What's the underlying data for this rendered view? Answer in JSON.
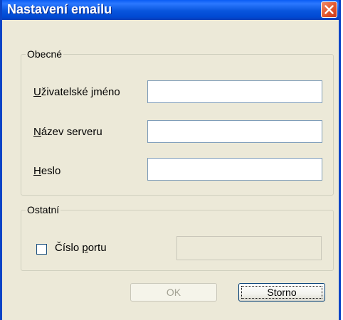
{
  "window": {
    "title": "Nastavení emailu"
  },
  "general": {
    "legend": "Obecné",
    "username": {
      "hotkey": "U",
      "rest": "živatelské jméno",
      "value": ""
    },
    "server": {
      "hotkey": "N",
      "rest": "ázev serveru",
      "value": ""
    },
    "password": {
      "hotkey": "H",
      "rest": "eslo",
      "value": ""
    }
  },
  "other": {
    "legend": "Ostatní",
    "port_checkbox": {
      "before": "Číslo ",
      "hotkey": "p",
      "after": "ortu",
      "checked": false
    },
    "port_value": ""
  },
  "buttons": {
    "ok": "OK",
    "cancel": "Storno"
  }
}
